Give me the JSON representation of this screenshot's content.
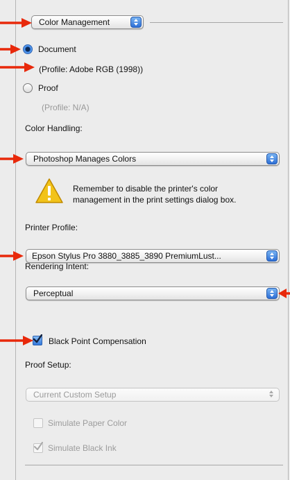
{
  "color_mode": {
    "selected": "Color Management"
  },
  "print_target": {
    "document_label": "Document",
    "document_profile": "(Profile: Adobe RGB (1998))",
    "proof_label": "Proof",
    "proof_profile": "(Profile: N/A)",
    "selected": "Document"
  },
  "color_handling": {
    "heading": "Color Handling:",
    "selected": "Photoshop Manages Colors",
    "warning": [
      "Remember to disable the printer's color",
      "management in the print settings dialog box."
    ]
  },
  "printer_profile": {
    "heading": "Printer Profile:",
    "selected": "Epson Stylus Pro 3880_3885_3890 PremiumLust..."
  },
  "rendering_intent": {
    "heading": "Rendering Intent:",
    "selected": "Perceptual"
  },
  "black_point_compensation": {
    "label": "Black Point Compensation",
    "checked": true
  },
  "proof_setup": {
    "heading": "Proof Setup:",
    "selected": "Current Custom Setup",
    "simulate_paper_color": {
      "label": "Simulate Paper Color",
      "checked": false
    },
    "simulate_black_ink": {
      "label": "Simulate Black Ink",
      "checked": true
    }
  },
  "colors": {
    "annotation_arrow": "#e8290b",
    "accent": "#3479dd",
    "warning_icon": "#f2c31a"
  },
  "icons": [
    "warning-icon",
    "popup-stepper-icon",
    "checkmark-icon",
    "annotation-arrow-icon"
  ]
}
